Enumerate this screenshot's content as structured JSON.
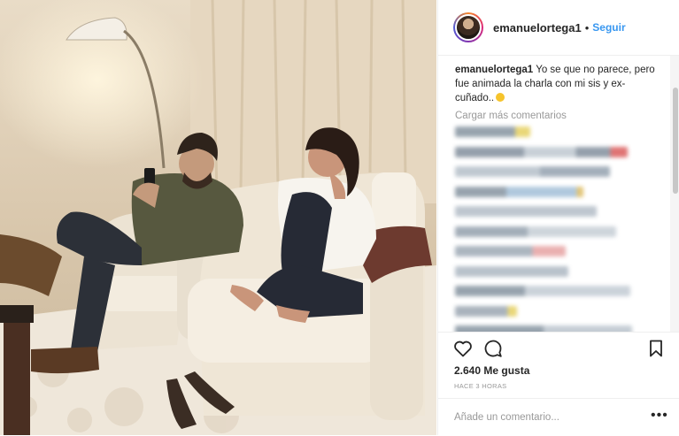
{
  "post": {
    "username": "emanuelortega1",
    "separator": "•",
    "follow_label": "Seguir",
    "caption_user": "emanuelortega1",
    "caption_text": "Yo se que no parece, pero fue animada la charla con mi sis y ex-cuñado..",
    "load_more_label": "Cargar más comentarios",
    "likes_text": "2.640 Me gusta",
    "time_text": "HACE 3 HORAS",
    "add_comment_placeholder": "Añade un comentario...",
    "more_label": "•••"
  },
  "icons": {
    "like": "heart-icon",
    "comment": "comment-icon",
    "save": "bookmark-icon",
    "more": "more-options-icon"
  },
  "colors": {
    "follow_blue": "#3897f0",
    "text": "#262626",
    "muted": "#999999"
  }
}
